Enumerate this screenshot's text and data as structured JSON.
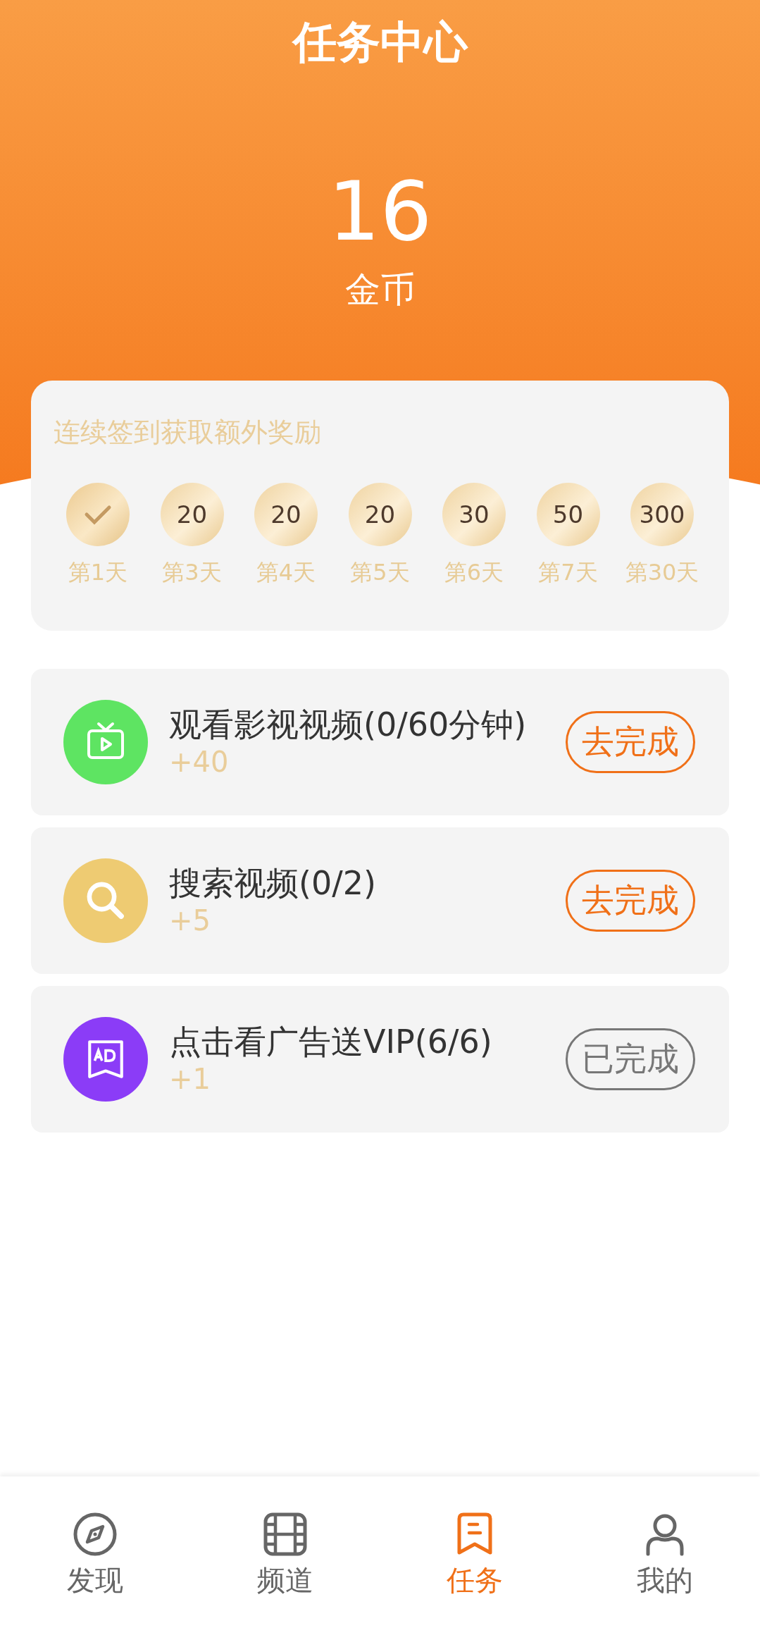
{
  "header": {
    "title": "任务中心",
    "coins": "16",
    "coins_label": "金币"
  },
  "signin": {
    "title": "连续签到获取额外奖励",
    "days": [
      {
        "label": "第1天",
        "checked": true
      },
      {
        "reward": "20",
        "label": "第3天",
        "checked": false
      },
      {
        "reward": "20",
        "label": "第4天",
        "checked": false
      },
      {
        "reward": "20",
        "label": "第5天",
        "checked": false
      },
      {
        "reward": "30",
        "label": "第6天",
        "checked": false
      },
      {
        "reward": "50",
        "label": "第7天",
        "checked": false
      },
      {
        "reward": "300",
        "label": "第30天",
        "checked": false
      }
    ]
  },
  "tasks": [
    {
      "kind": "tv",
      "color": "#5ee462",
      "title": "观看影视视频(0/60分钟)",
      "points": "+40",
      "button": "去完成",
      "done": false
    },
    {
      "kind": "search",
      "color": "#eecb72",
      "title": "搜索视频(0/2)",
      "points": "+5",
      "button": "去完成",
      "done": false
    },
    {
      "kind": "ad",
      "color": "#8b3cf7",
      "title": "点击看广告送VIP(6/6)",
      "points": "+1",
      "button": "已完成",
      "done": true
    }
  ],
  "tabbar": [
    {
      "kind": "compass",
      "label": "发现",
      "selected": false
    },
    {
      "kind": "film",
      "label": "频道",
      "selected": false
    },
    {
      "kind": "task",
      "label": "任务",
      "selected": true
    },
    {
      "kind": "person",
      "label": "我的",
      "selected": false
    }
  ]
}
